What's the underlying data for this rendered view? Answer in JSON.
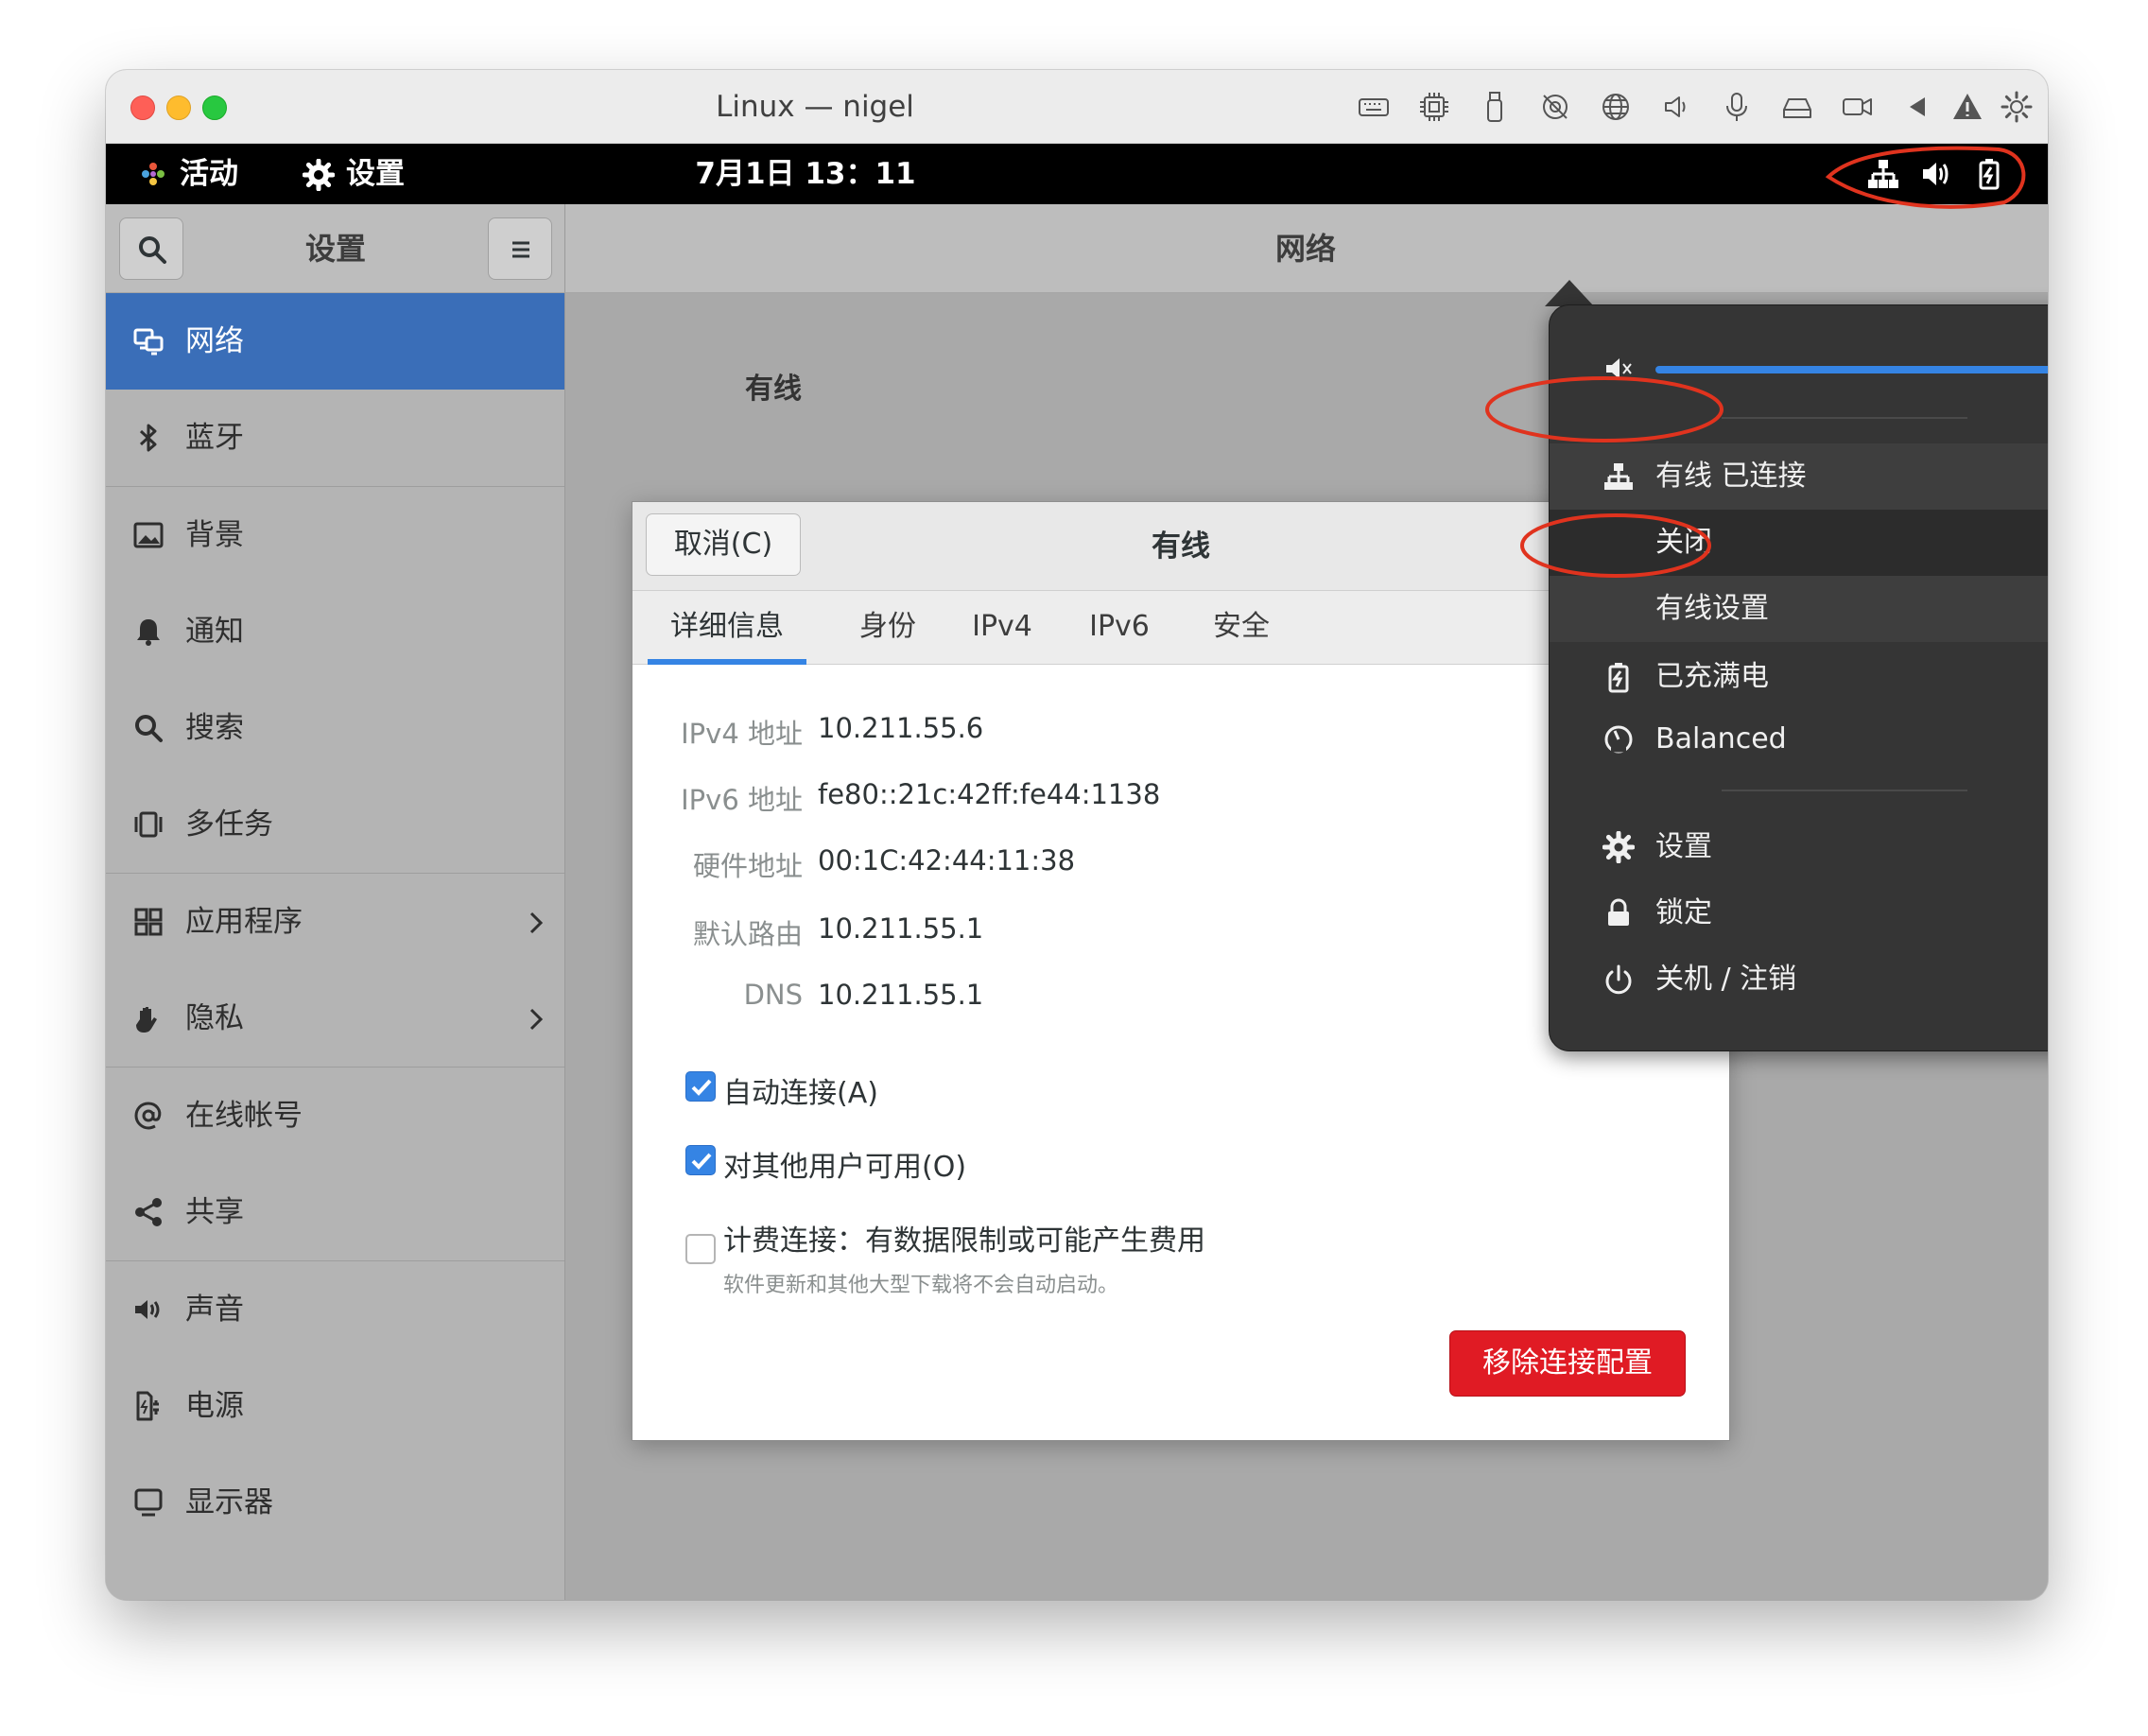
{
  "mac_window": {
    "title": "Linux — nigel",
    "toolbar_icons": [
      "keyboard-icon",
      "cpu-icon",
      "usb-icon",
      "camera-off-icon",
      "globe-icon",
      "speaker-icon",
      "microphone-icon",
      "drive-icon",
      "video-icon",
      "back-icon",
      "warning-icon",
      "gear-icon"
    ]
  },
  "topbar": {
    "activities": "活动",
    "app_name": "设置",
    "clock": "7月1日 13：11",
    "tray_icons": [
      "network-wired-icon",
      "volume-icon",
      "battery-icon"
    ]
  },
  "settings": {
    "sidebar_title": "设置",
    "content_title": "网络",
    "section_label": "有线",
    "sidebar_items": [
      {
        "label": "网络",
        "icon": "network-icon",
        "active": true
      },
      {
        "label": "蓝牙",
        "icon": "bluetooth-icon"
      },
      {
        "label": "背景",
        "icon": "background-icon"
      },
      {
        "label": "通知",
        "icon": "bell-icon"
      },
      {
        "label": "搜索",
        "icon": "search-icon"
      },
      {
        "label": "多任务",
        "icon": "multitask-icon"
      },
      {
        "label": "应用程序",
        "icon": "apps-icon",
        "chevron": true
      },
      {
        "label": "隐私",
        "icon": "hand-icon",
        "chevron": true
      },
      {
        "label": "在线帐号",
        "icon": "at-icon"
      },
      {
        "label": "共享",
        "icon": "share-icon"
      },
      {
        "label": "声音",
        "icon": "sound-icon"
      },
      {
        "label": "电源",
        "icon": "power-plug-icon"
      },
      {
        "label": "显示器",
        "icon": "display-icon"
      }
    ]
  },
  "dialog": {
    "title": "有线",
    "cancel_label": "取消(C)",
    "tabs": [
      {
        "label": "详细信息",
        "active": true
      },
      {
        "label": "身份"
      },
      {
        "label": "IPv4"
      },
      {
        "label": "IPv6"
      },
      {
        "label": "安全"
      }
    ],
    "details": [
      {
        "label": "IPv4 地址",
        "value": "10.211.55.6"
      },
      {
        "label": "IPv6 地址",
        "value": "fe80::21c:42ff:fe44:1138"
      },
      {
        "label": "硬件地址",
        "value": "00:1C:42:44:11:38"
      },
      {
        "label": "默认路由",
        "value": "10.211.55.1"
      },
      {
        "label": "DNS",
        "value": "10.211.55.1"
      }
    ],
    "auto_connect": {
      "label": "自动连接(A)",
      "checked": true
    },
    "all_users": {
      "label": "对其他用户可用(O)",
      "checked": true
    },
    "metered": {
      "label": "计费连接：有数据限制或可能产生费用",
      "sublabel": "软件更新和其他大型下载将不会自动启动。",
      "checked": false
    },
    "remove_label": "移除连接配置"
  },
  "system_menu": {
    "volume_level": 1.0,
    "wired_status": "有线 已连接",
    "wired_submenu": [
      "关闭",
      "有线设置"
    ],
    "battery_label": "已充满电",
    "power_mode_label": "Balanced",
    "settings_label": "设置",
    "lock_label": "锁定",
    "power_off_label": "关机 / 注销"
  },
  "colors": {
    "accent": "#3584e4",
    "sidebar_active": "#3a6eb8",
    "destructive": "#e01b24",
    "annotation": "#e0331e"
  }
}
